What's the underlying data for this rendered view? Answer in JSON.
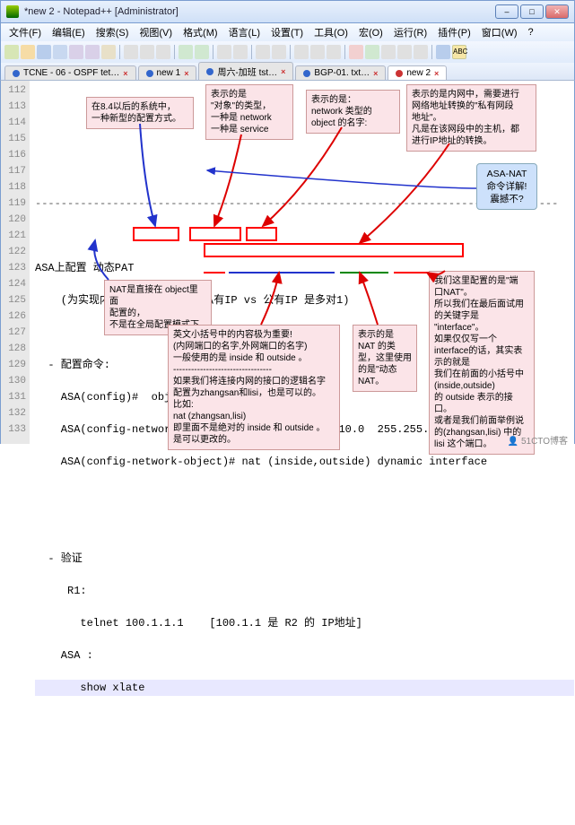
{
  "window": {
    "title": "*new 2 - Notepad++ [Administrator]"
  },
  "menu": {
    "file": "文件(F)",
    "edit": "编辑(E)",
    "search": "搜索(S)",
    "view": "视图(V)",
    "encoding": "格式(M)",
    "lang": "语言(L)",
    "settings": "设置(T)",
    "tools": "工具(O)",
    "macro": "宏(O)",
    "run": "运行(R)",
    "plugins": "插件(P)",
    "window": "窗口(W)",
    "help": "?"
  },
  "tabs": [
    {
      "label": "TCNE - 06 - OSPF tet…"
    },
    {
      "label": "new 1"
    },
    {
      "label": "周六-加班 tst…"
    },
    {
      "label": "BGP-01. txt…"
    },
    {
      "label": "new 2"
    }
  ],
  "gutter": [
    "112",
    "113",
    "114",
    "115",
    "116",
    "117",
    "118",
    "119",
    "120",
    "121",
    "122",
    "123",
    "124",
    "125",
    "126",
    "127",
    "128",
    "129",
    "130",
    "131",
    "132",
    "133"
  ],
  "code": {
    "l115": "---------------------------------------------------------------------------------",
    "l117a": "ASA上配置 动态PAT",
    "l118a": "    (为实现内网主机顺利上网 ：私有IP vs 公有IP 是多对1)",
    "l120a": "  - 配置命令:",
    "l121a": "    ASA(config)#  object  network NATT",
    "l122a": "    ASA(config-network-object)# subnet 192.168.10.0  255.255.255.0",
    "l123a": "    ASA(config-network-object)# nat (inside,outside) dynamic interface",
    "l126a": "  - 验证",
    "l127a": "     R1:",
    "l128a": "       telnet 100.1.1.1    [100.1.1 是 R2 的 IP地址]",
    "l129a": "    ASA :",
    "l130a": "       show xlate"
  },
  "notes": {
    "n1": "在8.4以后的系统中，\n一种新型的配置方式。",
    "n2": "表示的是\n\"对象\"的类型，\n一种是 network\n一种是 service",
    "n3": "表示的是：\nnetwork 类型的\nobject 的名字:",
    "n4": "表示的是内网中，需要进行\n网络地址转换的\"私有网段\n地址\"。\n凡是在该网段中的主机，都\n进行IP地址的转换。",
    "n5": "ASA-NAT\n命令详解!\n震撼不?",
    "n6": "NAT是直接在 object里面\n配置的，\n不是在全局配置模式下",
    "n7": "英文小括号中的内容极为重要!\n(内网端口的名字,外网端口的名字)\n一般使用的是 inside 和 outside 。\n---------------------------------\n如果我们将连接内网的接口的逻辑名字\n配置为zhangsan和lisi，也是可以的。\n比如:\nnat (zhangsan,lisi)\n即里面不是绝对的 inside 和 outside 。\n是可以更改的。",
    "n8": "表示的是\nNAT 的类\n型，这里使用\n的是\"动态\nNAT。",
    "n9": "我们这里配置的是\"端\n口NAT\"。\n所以我们在最后面试用\n的关键字是\n\"interface\"。\n如果仅仅写一个\ninterface的话，其实表\n示的就是\n我们在前面的小括号中\n(inside,outside)\n的 outside 表示的接\n口。\n或者是我们前面举例说\n的(zhangsan,lisi) 中的\nlisi 这个端口。"
  },
  "watermark": "👤 51CTO博客"
}
